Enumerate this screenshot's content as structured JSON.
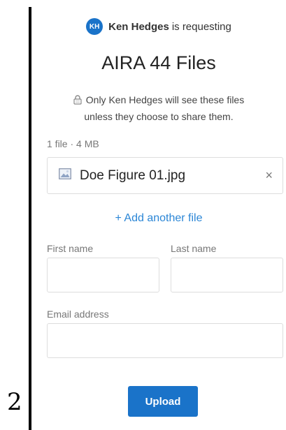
{
  "page_number": "2",
  "requester": {
    "initials": "KH",
    "name": "Ken Hedges",
    "suffix": "is requesting"
  },
  "title": "AIRA 44 Files",
  "privacy": {
    "line1": "Only Ken Hedges will see these files",
    "line2": "unless they choose to share them."
  },
  "files": {
    "summary": "1 file · 4 MB",
    "items": [
      {
        "name": "Doe Figure 01.jpg",
        "remove_symbol": "×"
      }
    ],
    "add_another_label": "+ Add another file"
  },
  "form": {
    "first_name_label": "First name",
    "first_name_value": "",
    "last_name_label": "Last name",
    "last_name_value": "",
    "email_label": "Email address",
    "email_value": ""
  },
  "upload_label": "Upload",
  "colors": {
    "accent": "#1a73c9",
    "link": "#2b86d6",
    "border": "#dddddd"
  }
}
